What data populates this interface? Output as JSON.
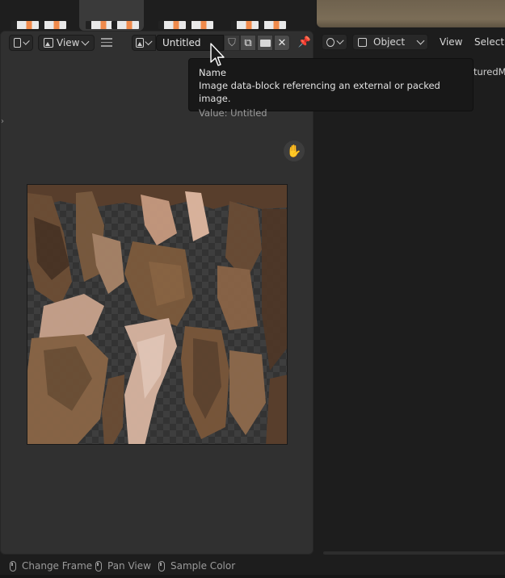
{
  "image_editor": {
    "header": {
      "editor_type_icon": "image-editor-icon",
      "view_menu": "View",
      "hamburger_icon": "hamburger-icon",
      "image_browse_icon": "image-icon",
      "image_name_value": "Untitled",
      "fake_user_icon": "shield-icon",
      "duplicate_icon": "duplicate-icon",
      "open_icon": "folder-icon",
      "unlink_icon": "close-icon",
      "pin_icon": "pin-icon"
    },
    "hand_icon": "hand-icon"
  },
  "viewport": {
    "header": {
      "shading_icon": "viewport-shading-icon",
      "mode_value": "Object",
      "view_menu": "View",
      "select_menu": "Select"
    },
    "cut_text": "turedMe"
  },
  "tooltip": {
    "title": "Name",
    "description": "Image data-block referencing an external or packed image.",
    "value": "Value: Untitled"
  },
  "status_bar": {
    "items": [
      {
        "label": "Change Frame",
        "icon": "mouse-left-icon"
      },
      {
        "label": "Pan View",
        "icon": "mouse-middle-icon"
      },
      {
        "label": "Sample Color",
        "icon": "mouse-right-icon"
      }
    ]
  },
  "colors": {
    "editor_bg": "#303030",
    "viewport_bg": "#1d1d1d",
    "tooltip_bg": "#181818",
    "texture_tone": "#8a6a4c"
  }
}
